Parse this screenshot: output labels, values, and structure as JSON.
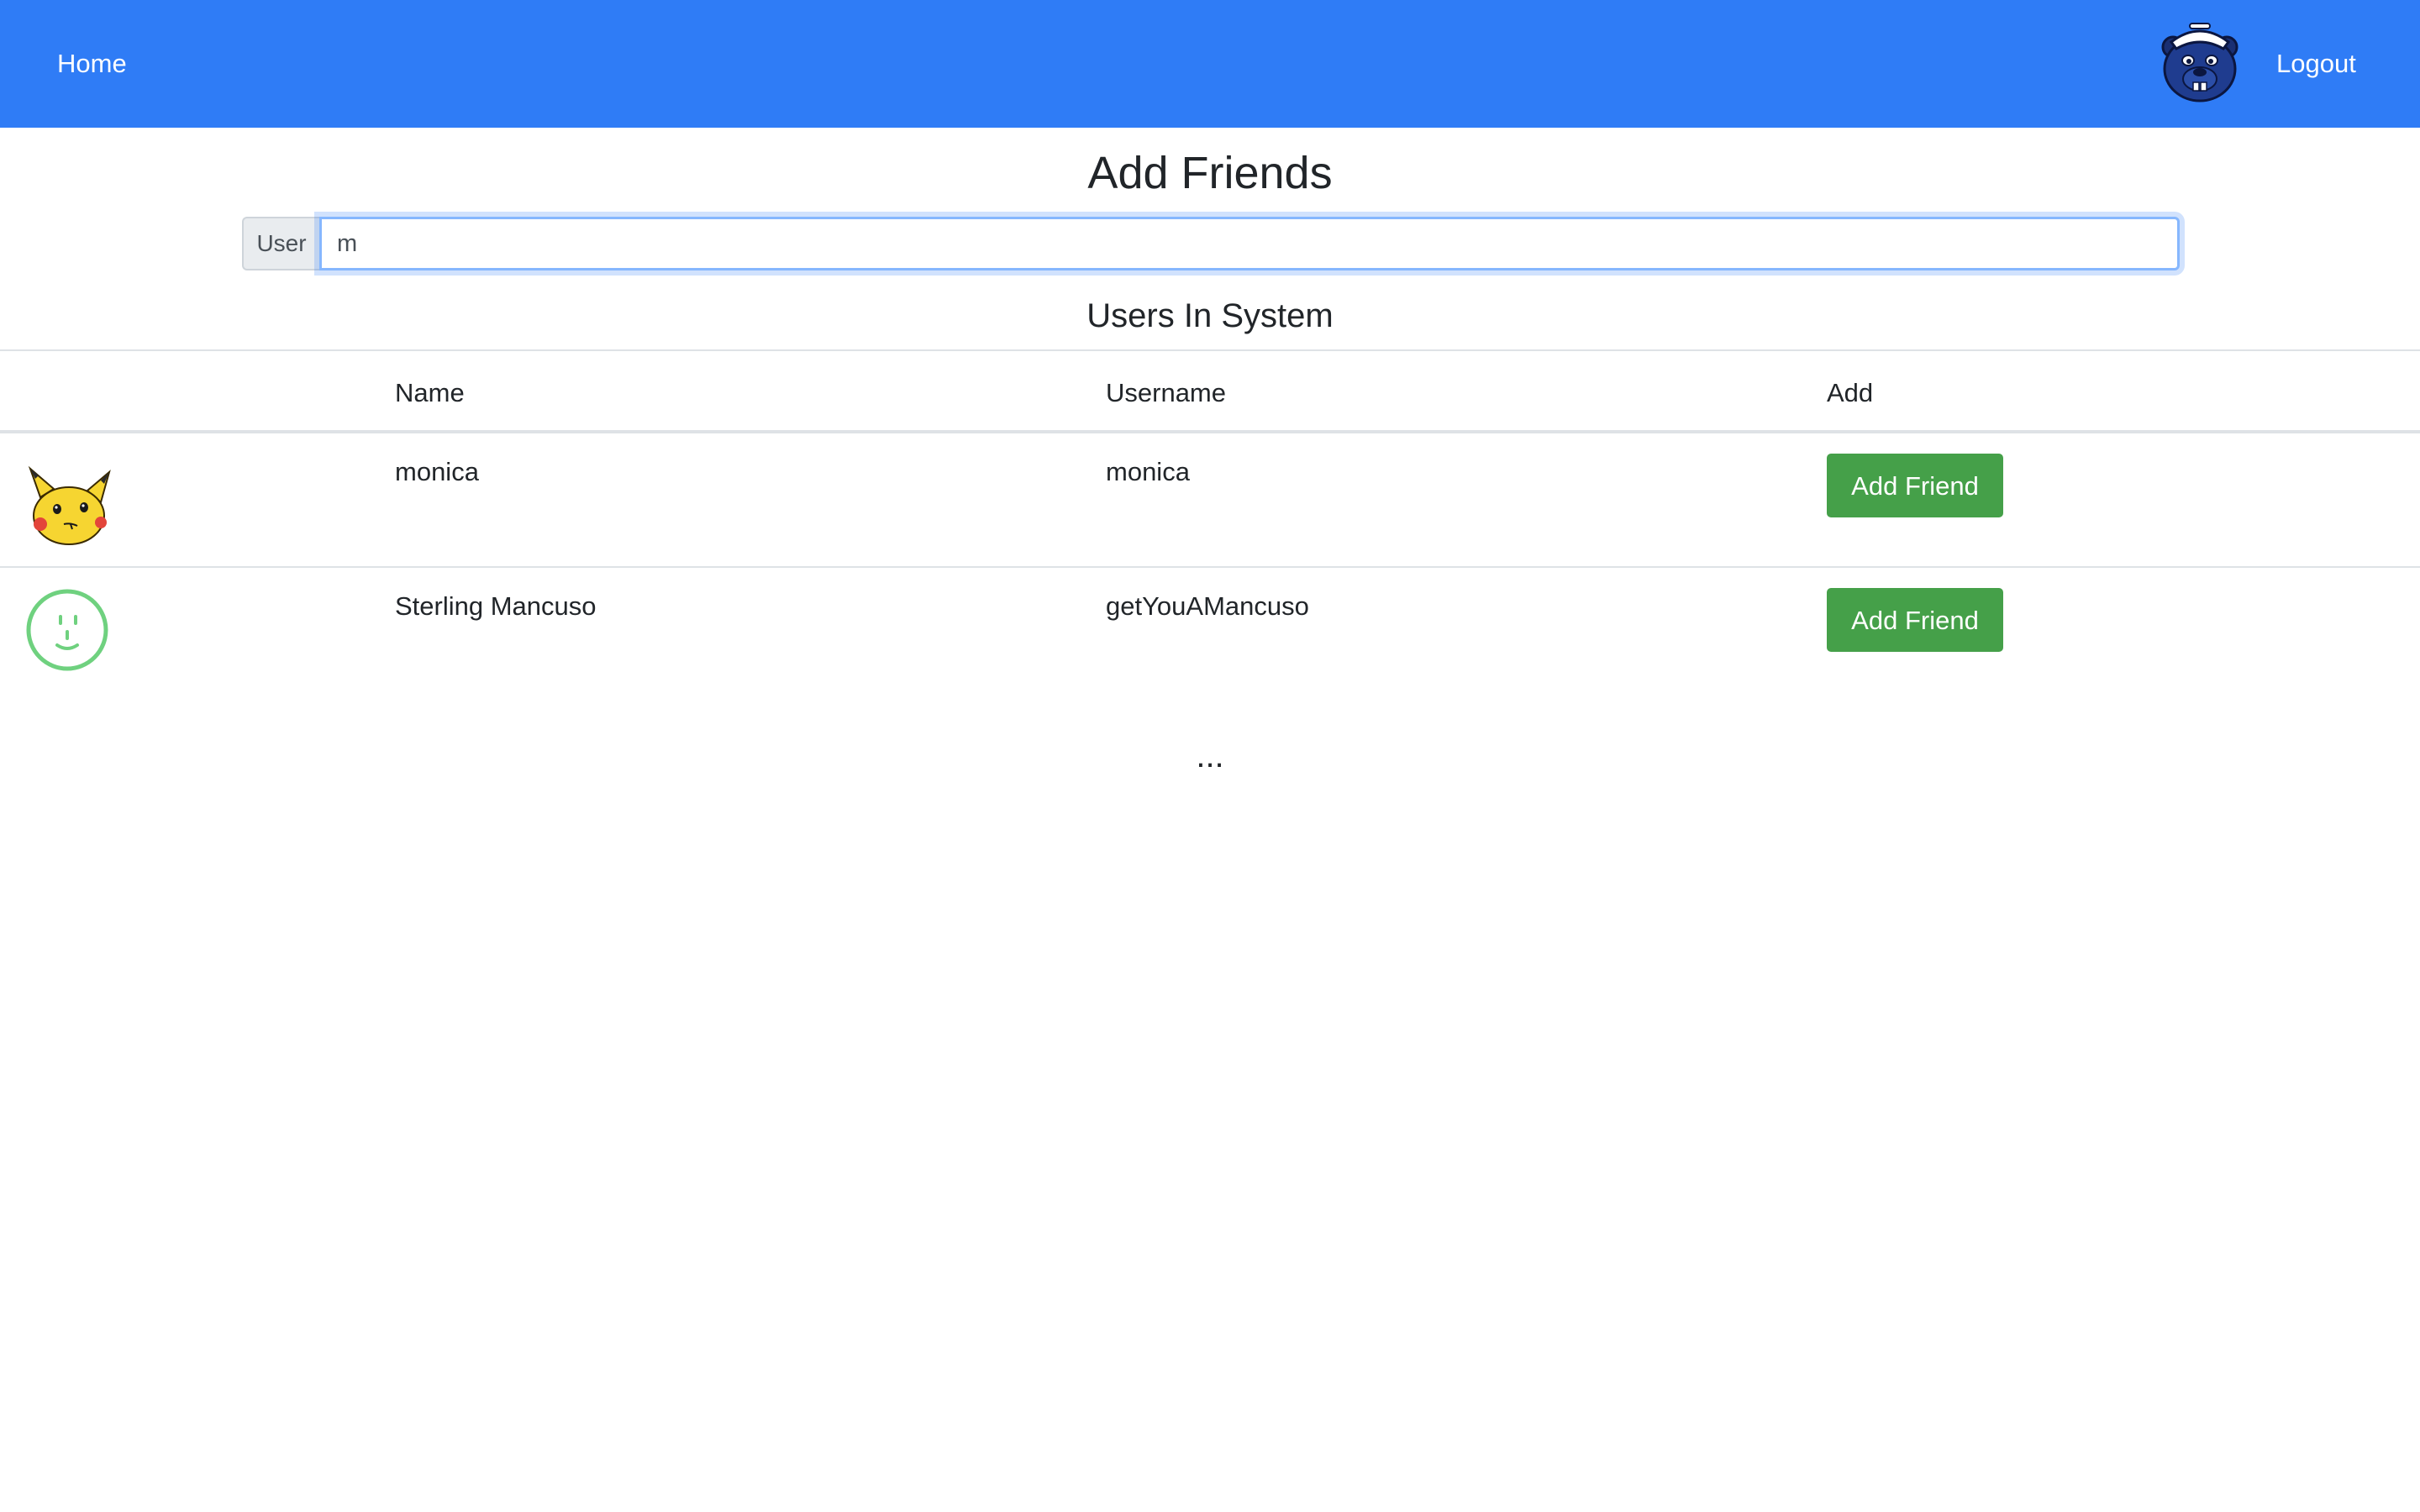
{
  "navbar": {
    "home_label": "Home",
    "logout_label": "Logout",
    "avatar_icon": "beaver-mascot-icon",
    "color": "#2f7cf6"
  },
  "page": {
    "title": "Add Friends"
  },
  "search": {
    "prepend_label": "User",
    "value": "m"
  },
  "users_section": {
    "title": "Users In System"
  },
  "table": {
    "columns": [
      "",
      "Name",
      "Username",
      "Add"
    ],
    "rows": [
      {
        "avatar_icon": "pikachu-icon",
        "name": "monica",
        "username": "monica",
        "button_label": "Add Friend"
      },
      {
        "avatar_icon": "smiley-face-icon",
        "name": "Sterling Mancuso",
        "username": "getYouAMancuso",
        "button_label": "Add Friend"
      }
    ]
  },
  "more_indicator": "...",
  "colors": {
    "button_green": "#45a049",
    "focus_border": "#86b7fe",
    "smiley_green": "#6fd17f"
  }
}
